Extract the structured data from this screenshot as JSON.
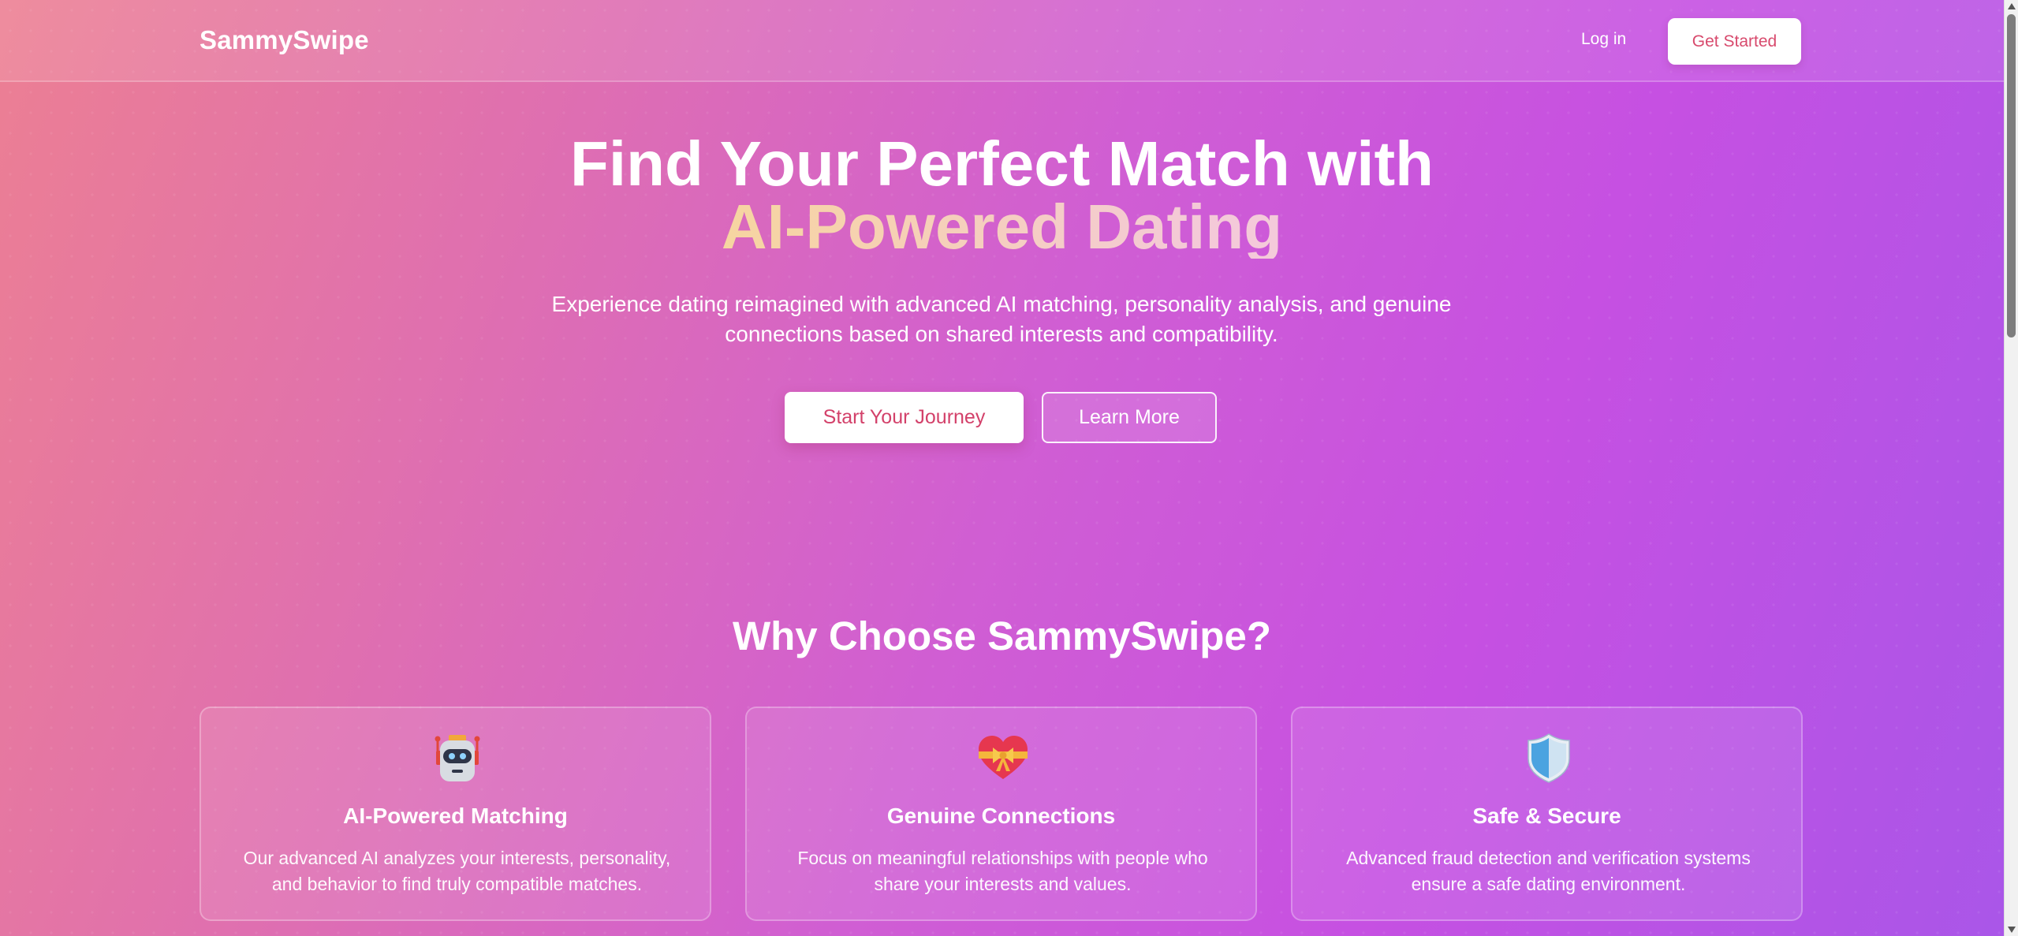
{
  "header": {
    "logo": "SammySwipe",
    "login_label": "Log in",
    "get_started_label": "Get Started"
  },
  "hero": {
    "title_line1": "Find Your Perfect Match with",
    "title_line2": "AI-Powered Dating",
    "subtitle_line1": "Experience dating reimagined with advanced AI matching, personality analysis, and genuine",
    "subtitle_line2": "connections based on shared interests and compatibility.",
    "primary_button": "Start Your Journey",
    "secondary_button": "Learn More"
  },
  "features": {
    "title": "Why Choose SammySwipe?",
    "cards": [
      {
        "icon": "robot-icon",
        "title": "AI-Powered Matching",
        "desc_line1": "Our advanced AI analyzes your interests, personality,",
        "desc_line2": "and behavior to find truly compatible matches."
      },
      {
        "icon": "heart-ribbon-icon",
        "title": "Genuine Connections",
        "desc_line1": "Focus on meaningful relationships with people who",
        "desc_line2": "share your interests and values."
      },
      {
        "icon": "shield-icon",
        "title": "Safe & Secure",
        "desc_line1": "Advanced fraud detection and verification systems",
        "desc_line2": "ensure a safe dating environment."
      }
    ]
  },
  "colors": {
    "gradient_start": "#ec7f93",
    "gradient_mid": "#d05ed3",
    "gradient_end": "#a956e8",
    "accent_text": "#d84a6d"
  }
}
